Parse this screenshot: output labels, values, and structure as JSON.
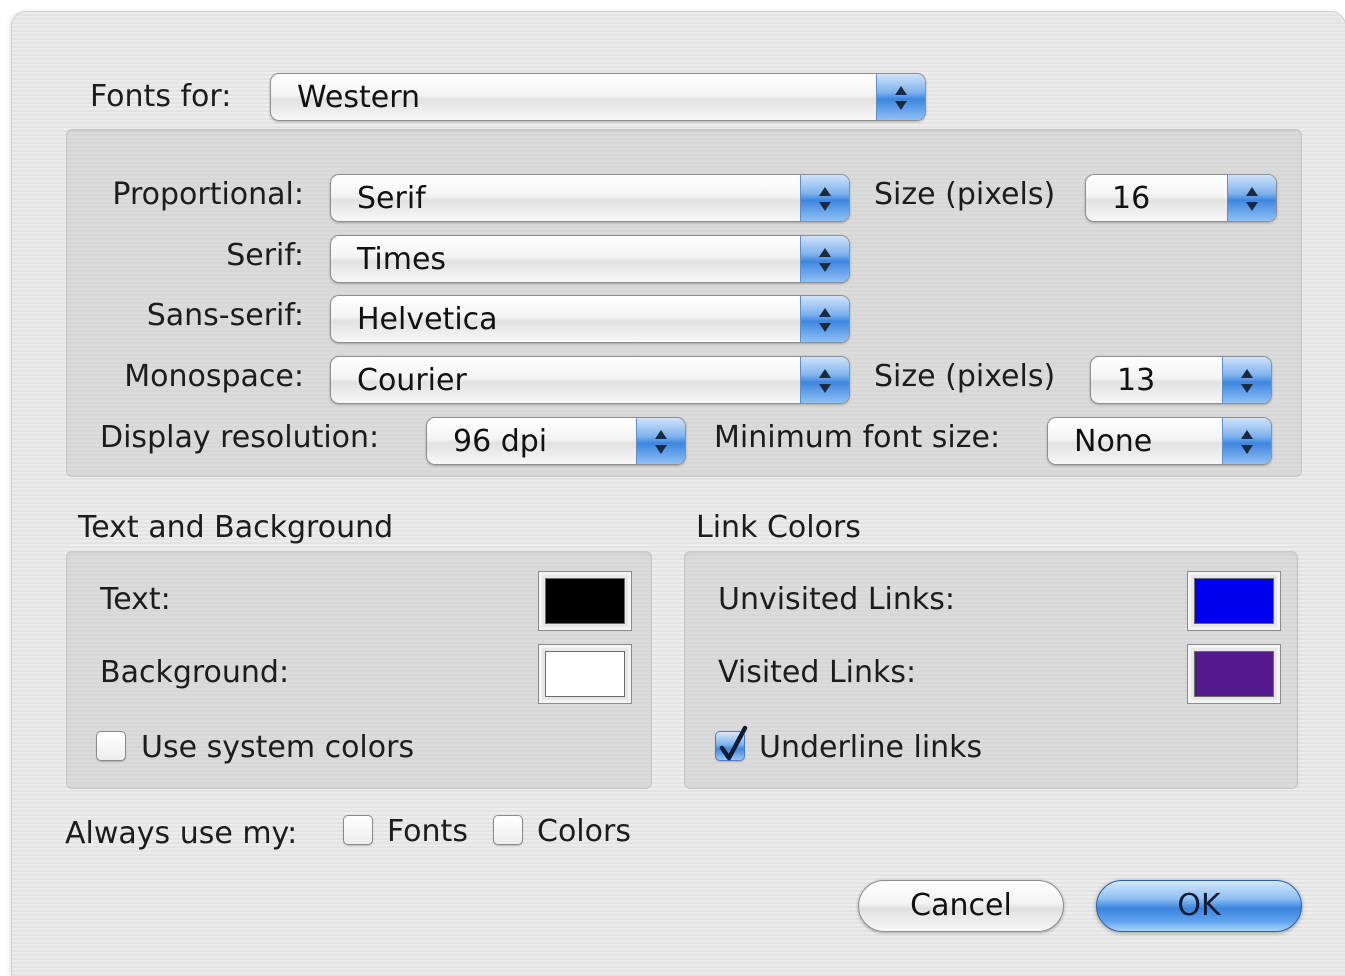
{
  "fonts_for": {
    "label": "Fonts for:",
    "value": "Western"
  },
  "font_settings": {
    "proportional": {
      "label": "Proportional:",
      "value": "Serif",
      "size_label": "Size (pixels)",
      "size_value": "16"
    },
    "serif": {
      "label": "Serif:",
      "value": "Times"
    },
    "sans_serif": {
      "label": "Sans-serif:",
      "value": "Helvetica"
    },
    "monospace": {
      "label": "Monospace:",
      "value": "Courier",
      "size_label": "Size (pixels)",
      "size_value": "13"
    },
    "display_resolution": {
      "label": "Display resolution:",
      "value": "96 dpi"
    },
    "minimum_font_size": {
      "label": "Minimum font size:",
      "value": "None"
    }
  },
  "text_and_background": {
    "title": "Text and Background",
    "text_label": "Text:",
    "text_color": "#000000",
    "background_label": "Background:",
    "background_color": "#ffffff",
    "use_system_colors_label": "Use system colors",
    "use_system_colors_checked": false
  },
  "link_colors": {
    "title": "Link Colors",
    "unvisited_label": "Unvisited Links:",
    "unvisited_color": "#0000ee",
    "visited_label": "Visited Links:",
    "visited_color": "#551a8b",
    "underline_label": "Underline links",
    "underline_checked": true
  },
  "always_use": {
    "label": "Always use my:",
    "fonts_label": "Fonts",
    "fonts_checked": false,
    "colors_label": "Colors",
    "colors_checked": false
  },
  "buttons": {
    "cancel": "Cancel",
    "ok": "OK"
  }
}
